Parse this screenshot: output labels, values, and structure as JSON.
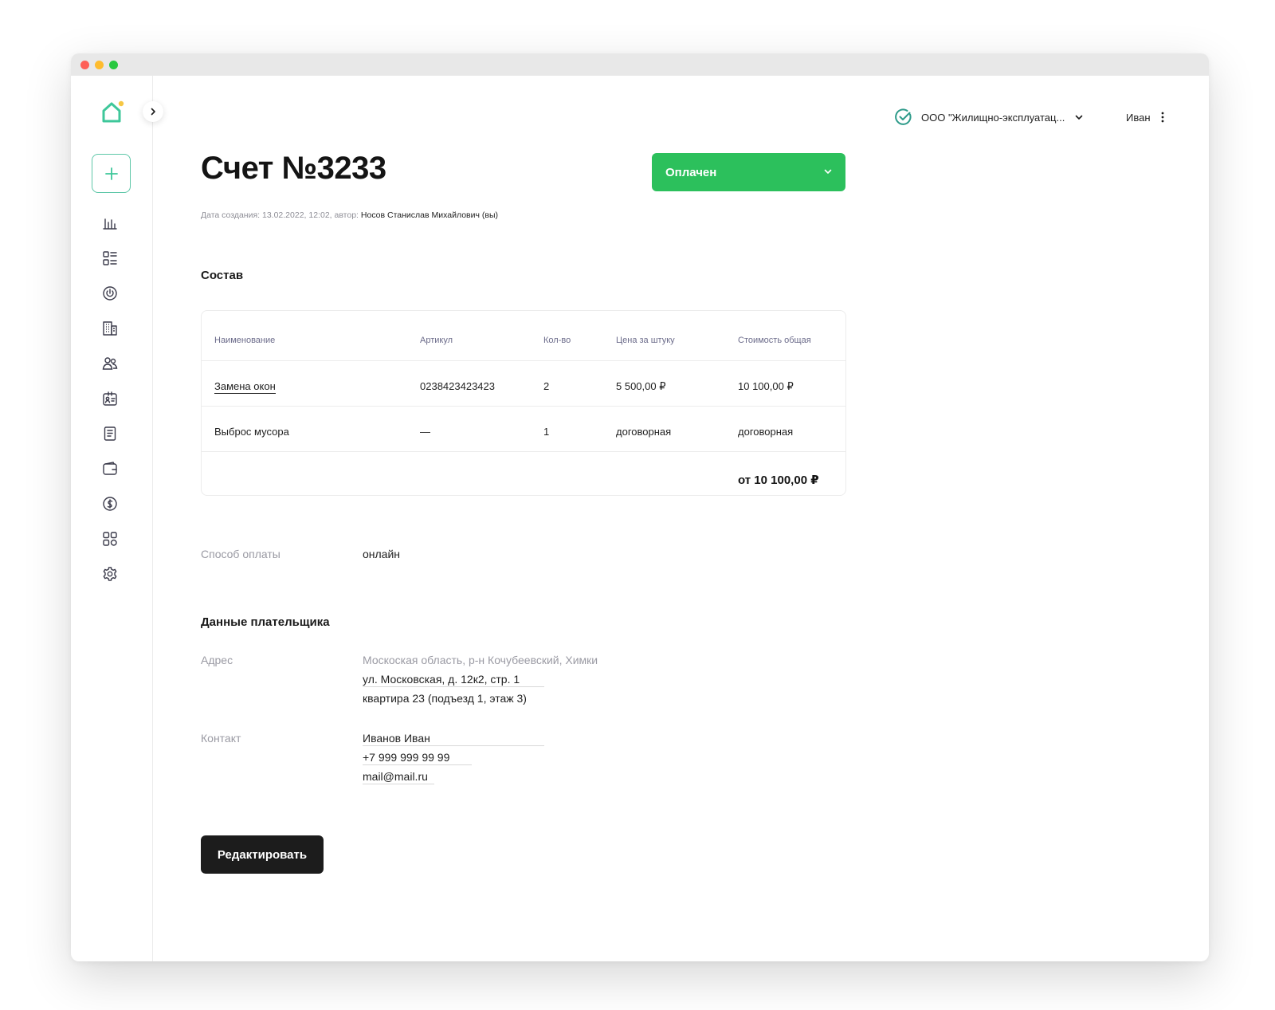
{
  "header": {
    "org_name": "ООО \"Жилищно-эксплуатац...",
    "user_name": "Иван"
  },
  "invoice": {
    "title": "Счет №3233",
    "status": "Оплачен",
    "meta_prefix": "Дата создания: 13.02.2022, 12:02, автор:",
    "meta_author": "Носов Станислав Михайлович (вы)"
  },
  "composition": {
    "title": "Состав",
    "columns": [
      "Наименование",
      "Артикул",
      "Кол-во",
      "Цена за штуку",
      "Стоимость общая"
    ],
    "rows": [
      {
        "name": "Замена окон",
        "sku": "0238423423423",
        "qty": "2",
        "price": "5 500,00 ₽",
        "total": "10 100,00 ₽"
      },
      {
        "name": "Выброс мусора",
        "sku": "—",
        "qty": "1",
        "price": "договорная",
        "total": "договорная"
      }
    ],
    "grand_total": "от 10 100,00 ₽"
  },
  "payment": {
    "label": "Способ оплаты",
    "value": "онлайн"
  },
  "payer": {
    "title": "Данные плательщика",
    "address_label": "Адрес",
    "address_line1": "Москоская область, р-н Кочубеевский, Химки",
    "address_line2": "ул. Московская, д. 12к2, стр. 1",
    "address_line3": "квартира 23 (подъезд 1, этаж 3)",
    "contact_label": "Контакт",
    "contact_name": "Иванов Иван",
    "contact_phone": "+7 999 999 99 99",
    "contact_email": "mail@mail.ru"
  },
  "actions": {
    "edit_label": "Редактировать"
  },
  "icons": {
    "logo": "house-logo-icon",
    "nav": [
      "chart-icon",
      "list-icon",
      "power-icon",
      "building-icon",
      "users-icon",
      "id-card-icon",
      "document-icon",
      "wallet-icon",
      "coin-icon",
      "grid-icon",
      "gear-icon"
    ]
  },
  "colors": {
    "status_green": "#2cc05c",
    "accent_teal": "#5ec7a8",
    "logo_yellow": "#f6c744",
    "dark_button": "#1c1c1c"
  }
}
